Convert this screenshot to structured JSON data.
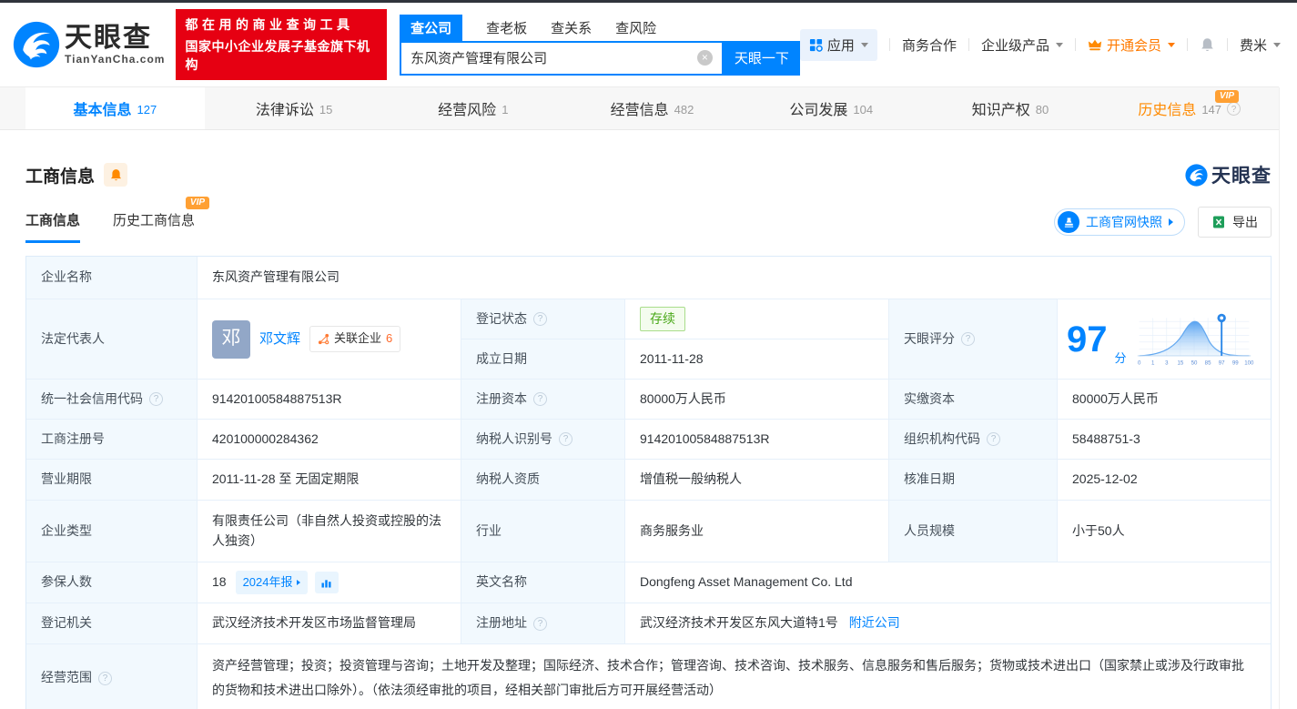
{
  "header": {
    "logo": {
      "name": "天眼查",
      "domain": "TianYanCha.com"
    },
    "slogan_line1": "都在用的商业查询工具",
    "slogan_line2": "国家中小企业发展子基金旗下机构",
    "search": {
      "tabs": [
        {
          "label": "查公司"
        },
        {
          "label": "查老板"
        },
        {
          "label": "查关系"
        },
        {
          "label": "查风险"
        }
      ],
      "value": "东风资产管理有限公司",
      "button": "天眼一下"
    },
    "nav": {
      "apps": "应用",
      "cooperation": "商务合作",
      "enterprise": "企业级产品",
      "vip": "开通会员",
      "username": "费米"
    }
  },
  "tabs": [
    {
      "label": "基本信息",
      "count": "127"
    },
    {
      "label": "法律诉讼",
      "count": "15"
    },
    {
      "label": "经营风险",
      "count": "1"
    },
    {
      "label": "经营信息",
      "count": "482"
    },
    {
      "label": "公司发展",
      "count": "104"
    },
    {
      "label": "知识产权",
      "count": "80"
    },
    {
      "label": "历史信息",
      "count": "147",
      "vip": "VIP"
    }
  ],
  "section": {
    "title": "工商信息",
    "watermark": "天眼查",
    "subtab_current": "工商信息",
    "subtab_history": "历史工商信息",
    "vip_badge": "VIP",
    "snapshot_button": "工商官网快照",
    "export_button": "导出"
  },
  "table": {
    "company_name_label": "企业名称",
    "company_name": "东风资产管理有限公司",
    "legal_rep_label": "法定代表人",
    "legal_rep_avatar": "邓",
    "legal_rep_name": "邓文辉",
    "related_label": "关联企业",
    "related_count": "6",
    "reg_status_label": "登记状态",
    "reg_status": "存续",
    "establish_label": "成立日期",
    "establish_date": "2011-11-28",
    "score_label": "天眼评分",
    "score_value": "97",
    "score_unit": "分",
    "credit_code_label": "统一社会信用代码",
    "credit_code": "91420100584887513R",
    "reg_capital_label": "注册资本",
    "reg_capital": "80000万人民币",
    "paid_capital_label": "实缴资本",
    "paid_capital": "80000万人民币",
    "reg_number_label": "工商注册号",
    "reg_number": "420100000284362",
    "taxpayer_id_label": "纳税人识别号",
    "taxpayer_id": "91420100584887513R",
    "org_code_label": "组织机构代码",
    "org_code": "58488751-3",
    "term_label": "营业期限",
    "term": "2011-11-28 至 无固定期限",
    "taxpayer_quality_label": "纳税人资质",
    "taxpayer_quality": "增值税一般纳税人",
    "approval_label": "核准日期",
    "approval_date": "2025-12-02",
    "type_label": "企业类型",
    "company_type": "有限责任公司（非自然人投资或控股的法人独资）",
    "industry_label": "行业",
    "industry": "商务服务业",
    "staff_label": "人员规模",
    "staff_size": "小于50人",
    "insured_label": "参保人数",
    "insured_count": "18",
    "insured_report": "2024年报",
    "english_label": "英文名称",
    "english_name": "Dongfeng Asset Management Co. Ltd",
    "authority_label": "登记机关",
    "authority": "武汉经济技术开发区市场监督管理局",
    "address_label": "注册地址",
    "address": "武汉经济技术开发区东风大道特1号",
    "nearby_link": "附近公司",
    "scope_label": "经营范围",
    "scope": "资产经营管理；投资；投资管理与咨询；土地开发及整理；国际经济、技术合作；管理咨询、技术咨询、技术服务、信息服务和售后服务；货物或技术进出口（国家禁止或涉及行政审批的货物和技术进出口除外）。（依法须经审批的项目，经相关部门审批后方可开展经营活动）"
  },
  "score_chart": {
    "type": "area",
    "value": 97,
    "ticks": [
      "0",
      "1",
      "3",
      "15",
      "50",
      "85",
      "97",
      "99",
      "100"
    ],
    "marker_at": "97"
  }
}
